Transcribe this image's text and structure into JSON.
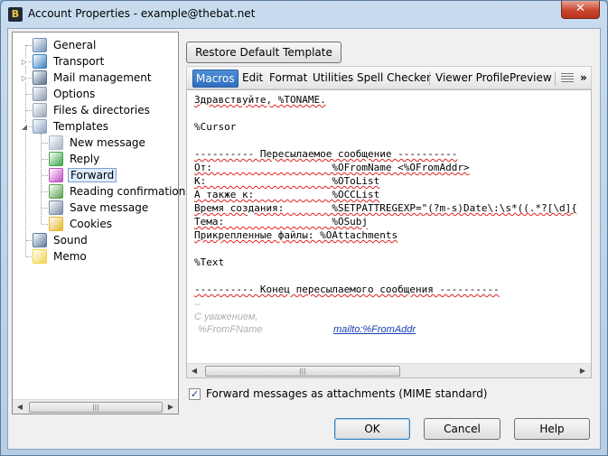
{
  "window": {
    "title": "Account Properties - example@thebat.net",
    "close_symbol": "✕",
    "app_icon_glyph": "B"
  },
  "tree": {
    "items": [
      {
        "label": "General",
        "icon": "general-icon",
        "color": "#6f8fb8"
      },
      {
        "label": "Transport",
        "icon": "transport-icon",
        "color": "#3b7fbf"
      },
      {
        "label": "Mail management",
        "icon": "mail-management-icon",
        "color": "#5a6f8f"
      },
      {
        "label": "Options",
        "icon": "options-icon",
        "color": "#8a9bb0"
      },
      {
        "label": "Files & directories",
        "icon": "files-icon",
        "color": "#9aa7b8"
      },
      {
        "label": "Templates",
        "icon": "templates-icon",
        "color": "#8aa0c2"
      },
      {
        "label": "New message",
        "icon": "new-message-icon",
        "color": "#a9b5c9"
      },
      {
        "label": "Reply",
        "icon": "reply-icon",
        "color": "#3ea34a"
      },
      {
        "label": "Forward",
        "icon": "forward-icon",
        "color": "#c04ec4"
      },
      {
        "label": "Reading confirmation",
        "icon": "reading-confirmation-icon",
        "color": "#5da14d"
      },
      {
        "label": "Save message",
        "icon": "save-message-icon",
        "color": "#7a8aa6"
      },
      {
        "label": "Cookies",
        "icon": "cookies-icon",
        "color": "#e4b52a"
      },
      {
        "label": "Sound",
        "icon": "sound-icon",
        "color": "#5d7aa0"
      },
      {
        "label": "Memo",
        "icon": "memo-icon",
        "color": "#f2d24c"
      }
    ],
    "expander_collapsed": "▷",
    "expander_expanded": "◢"
  },
  "restore_button": "Restore Default Template",
  "toolbar": {
    "items": [
      "Macros",
      "Edit",
      "Format",
      "Utilities",
      "Spell Checker",
      "Viewer Profile",
      "Preview"
    ],
    "overflow": "»"
  },
  "editor": {
    "lines": [
      "Здравствуйте, %TONAME.",
      "",
      "%Cursor",
      "",
      "---------- Пересылаемое сообщение ----------",
      "От:                    %OFromName <%OFromAddr>",
      "К:                     %OToList",
      "А также к:             %OCCList",
      "Время создания:        %SETPATTREGEXP=\"(?m-s)Date\\:\\s*((.*?[\\d]{",
      "Тема:                  %OSubj",
      "Прикрепленные файлы: %OAttachments",
      "",
      "%Text",
      "",
      "---------- Конец пересылаемого сообщения ----------"
    ],
    "signature_dash": "--",
    "signature_greeting": "С уважением,",
    "signature_name": "%FromFName",
    "signature_link": "mailto:%FromAddr"
  },
  "forward_checkbox": {
    "checked": true,
    "label": "Forward messages as attachments (MIME standard)"
  },
  "buttons": {
    "ok": "OK",
    "cancel": "Cancel",
    "help": "Help"
  }
}
